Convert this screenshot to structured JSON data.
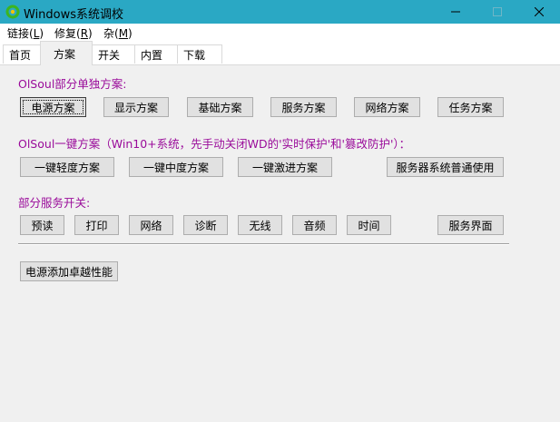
{
  "window": {
    "title": "Windows系统调校"
  },
  "menubar": {
    "items": [
      {
        "label": "链接(",
        "accel": "L",
        "tail": ")"
      },
      {
        "label": "修复(",
        "accel": "R",
        "tail": ")"
      },
      {
        "label": "杂(",
        "accel": "M",
        "tail": ")"
      }
    ]
  },
  "tabs": [
    "首页",
    "方案",
    "开关",
    "内置",
    "下载"
  ],
  "active_tab": "方案",
  "sections": {
    "single": {
      "label": "OlSoul部分单独方案:",
      "buttons": [
        "电源方案",
        "显示方案",
        "基础方案",
        "服务方案",
        "网络方案",
        "任务方案"
      ]
    },
    "onekey": {
      "label": "OlSoul一键方案（Win10+系统，先手动关闭WD的'实时保护'和'篡改防护'）：",
      "buttons": [
        "一键轻度方案",
        "一键中度方案",
        "一键激进方案",
        "服务器系统普通使用"
      ]
    },
    "services": {
      "label": "部分服务开关:",
      "buttons": [
        "预读",
        "打印",
        "网络",
        "诊断",
        "无线",
        "音频",
        "时间",
        "服务界面"
      ]
    },
    "extra": {
      "buttons": [
        "电源添加卓越性能"
      ]
    }
  },
  "colors": {
    "titlebar": "#2aa8c4",
    "section_label": "#9a0b9a",
    "button_face": "#e1e1e1"
  }
}
